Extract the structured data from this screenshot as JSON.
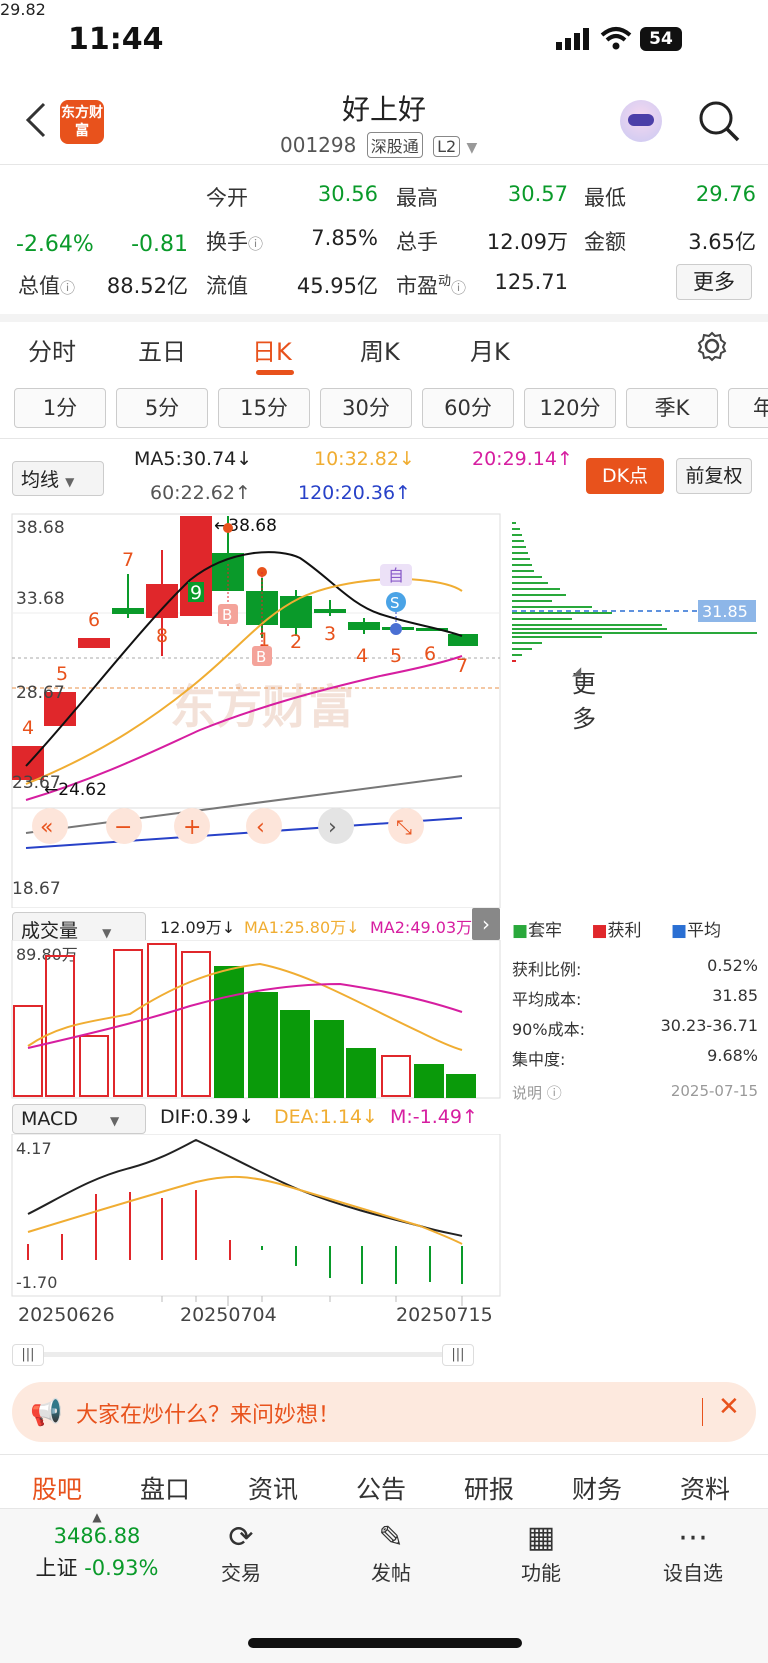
{
  "status": {
    "time": "11:44",
    "battery": "54"
  },
  "header": {
    "title": "好上好",
    "code": "001298",
    "tag1": "深股通",
    "tag2": "L2",
    "logo": "东方财富"
  },
  "quote": {
    "price": "29.82",
    "pct": "-2.64%",
    "chg": "-0.81",
    "open_label": "今开",
    "open": "30.56",
    "high_label": "最高",
    "high": "30.57",
    "low_label": "最低",
    "low": "29.76",
    "turnover_label": "换手",
    "turnover": "7.85%",
    "volume_label": "总手",
    "volume": "12.09万",
    "amount_label": "金额",
    "amount": "3.65亿",
    "mcap_label": "总值",
    "mcap": "88.52亿",
    "float_label": "流值",
    "float": "45.95亿",
    "pe_label": "市盈",
    "pe_sup": "动",
    "pe": "125.71",
    "more": "更多"
  },
  "tabs": [
    "分时",
    "五日",
    "日K",
    "周K",
    "月K",
    "更多"
  ],
  "periods": [
    "1分",
    "5分",
    "15分",
    "30分",
    "60分",
    "120分",
    "季K",
    "年"
  ],
  "ma": {
    "selector": "均线",
    "ma5": "MA5:30.74↓",
    "ma10": "10:32.82↓",
    "ma20": "20:29.14↑",
    "ma60": "60:22.62↑",
    "ma120": "120:20.36↑",
    "dk": "DK点",
    "fq": "前复权"
  },
  "kline": {
    "y_labels": [
      "38.68",
      "33.68",
      "28.67",
      "23.67",
      "18.67"
    ],
    "high_mark": "38.68",
    "low_mark": "24.62",
    "day_numbers": [
      "4",
      "5",
      "6",
      "7",
      "8",
      "9",
      "1",
      "2",
      "3",
      "4",
      "5",
      "6",
      "7"
    ],
    "signals": [
      "B",
      "B",
      "自",
      "S"
    ],
    "watermark": "东方财富",
    "cost_line": "31.85",
    "controls": [
      "«",
      "−",
      "+",
      "‹",
      "›",
      "⤡"
    ]
  },
  "volume": {
    "selector": "成交量",
    "vol": "12.09万↓",
    "ma1": "MA1:25.80万↓",
    "ma2": "MA2:49.03万",
    "ymax": "89.80万"
  },
  "macd": {
    "selector": "MACD",
    "dif": "DIF:0.39↓",
    "dea": "DEA:1.14↓",
    "m": "M:-1.49↑",
    "ymax": "4.17",
    "ymin": "-1.70"
  },
  "dates": [
    "20250626",
    "20250704",
    "20250715"
  ],
  "chips": {
    "legend": [
      "套牢",
      "获利",
      "平均"
    ],
    "rows": [
      {
        "label": "获利比例:",
        "value": "0.52%"
      },
      {
        "label": "平均成本:",
        "value": "31.85"
      },
      {
        "label": "90%成本:",
        "value": "30.23-36.71"
      },
      {
        "label": "集中度:",
        "value": "9.68%"
      }
    ],
    "note": "说明",
    "date": "2025-07-15"
  },
  "banner": {
    "text": "大家在炒什么？来问妙想！"
  },
  "bottom_tabs": [
    "股吧",
    "盘口",
    "资讯",
    "公告",
    "研报",
    "财务",
    "资料"
  ],
  "nav": {
    "index_value": "3486.88",
    "index_name": "上证",
    "index_pct": "-0.93%",
    "items": [
      "交易",
      "发帖",
      "功能",
      "设自选"
    ]
  },
  "colors": {
    "up": "#e0272b",
    "down": "#0a9a2a",
    "accent": "#e8521c"
  }
}
